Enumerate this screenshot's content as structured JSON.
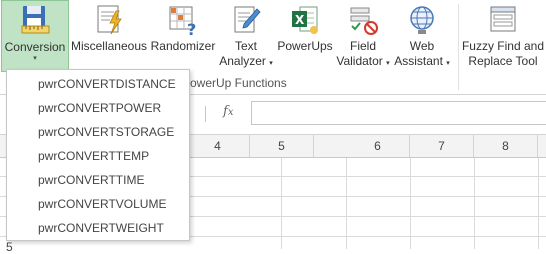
{
  "ribbon": {
    "buttons": [
      {
        "label": "Conversion",
        "caret": "▾",
        "icon": "ruler-floppy-icon"
      },
      {
        "label": "Miscellaneous",
        "icon": "document-lightning-icon"
      },
      {
        "label": "Randomizer",
        "icon": "grid-question-icon"
      },
      {
        "label": "Text",
        "label2": "Analyzer",
        "caret": "▾",
        "icon": "pencil-document-icon"
      },
      {
        "label": "PowerUps",
        "icon": "excel-document-icon"
      },
      {
        "label": "Field",
        "label2": "Validator",
        "caret": "▾",
        "icon": "validator-icon"
      },
      {
        "label": "Web",
        "label2": "Assistant",
        "caret": "▾",
        "icon": "globe-icon"
      },
      {
        "label": "Fuzzy Find and",
        "label2": "Replace Tool",
        "icon": "window-lines-icon"
      }
    ],
    "group_label": "PowerUp Functions",
    "group_label_visible": "owerUp Functions"
  },
  "formula_bar": {
    "fx_label": "fx",
    "cancel_label": "⋮"
  },
  "grid": {
    "column_headers": [
      "4",
      "5",
      "6",
      "7",
      "8"
    ],
    "row_header_visible": "5"
  },
  "menu": {
    "items": [
      "pwrCONVERTDISTANCE",
      "pwrCONVERTPOWER",
      "pwrCONVERTSTORAGE",
      "pwrCONVERTTEMP",
      "pwrCONVERTTIME",
      "pwrCONVERTVOLUME",
      "pwrCONVERTWEIGHT"
    ]
  },
  "colors": {
    "active_button_bg": "#bfe3c4",
    "active_button_border": "#8dc596",
    "excel_green": "#217346"
  }
}
